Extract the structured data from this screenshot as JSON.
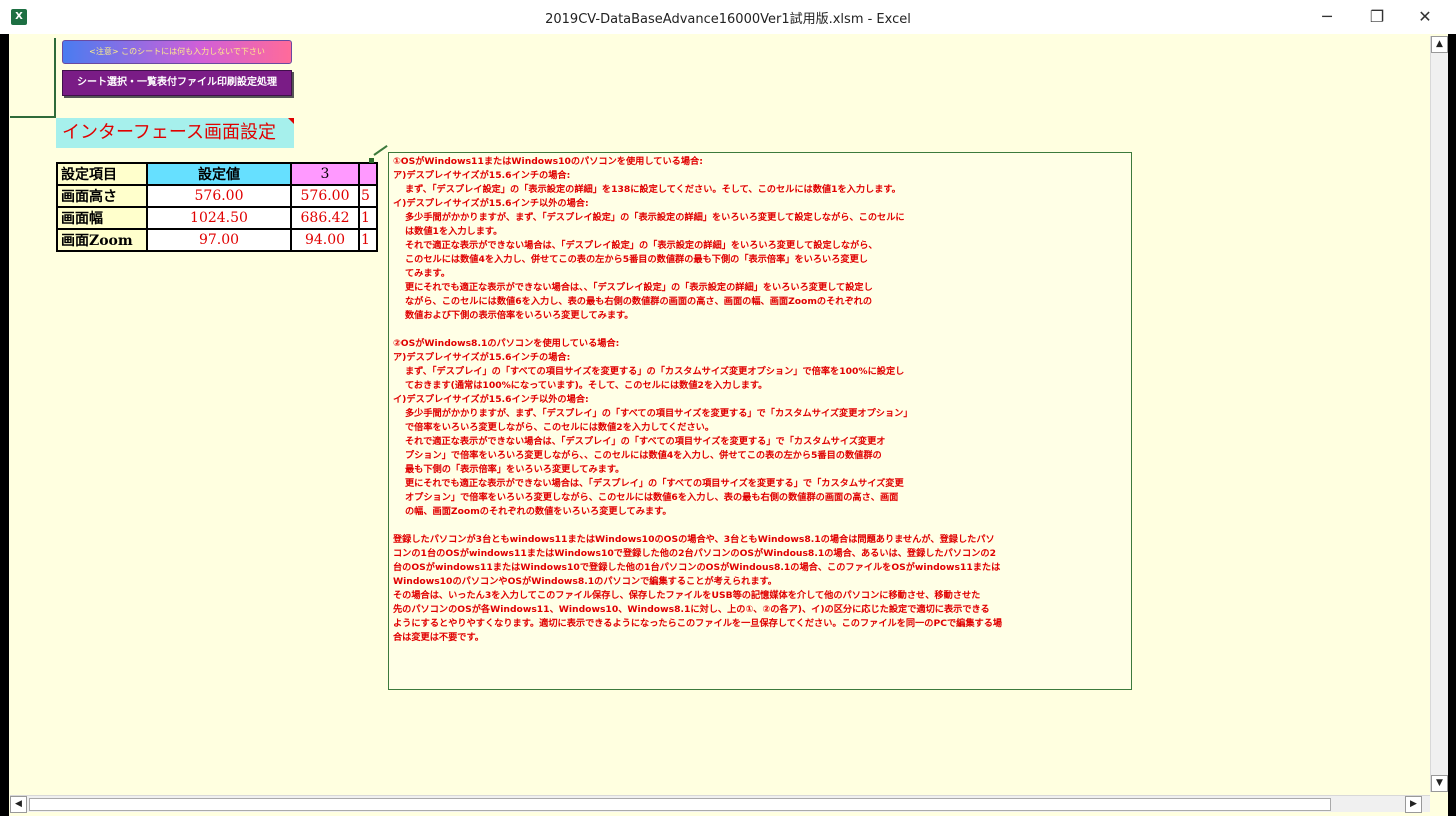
{
  "window": {
    "title": "2019CV-DataBaseAdvance16000Ver1試用版.xlsm - Excel",
    "app_icon": "excel-icon",
    "controls": [
      "minimize-icon",
      "restore-icon",
      "close-icon"
    ]
  },
  "buttons": {
    "notice": "<注意> このシートには何も入力しないで下さい",
    "print_setup": "シート選択・一覧表付ファイル印刷設定処理"
  },
  "section_title": "インターフェース画面設定",
  "settings_table": {
    "headers": [
      "設定項目",
      "設定値",
      "3",
      ""
    ],
    "rows": [
      {
        "label": "画面高さ",
        "value": "576.00",
        "v3": "576.00",
        "v4": "5"
      },
      {
        "label": "画面幅",
        "value": "1024.50",
        "v3": "686.42",
        "v4": "1"
      },
      {
        "label": "画面Zoom",
        "value": "97.00",
        "v3": "94.00",
        "v4": "1"
      }
    ]
  },
  "comment": {
    "lines": [
      "①OSがWindows11またはWindows10のパソコンを使用している場合:",
      "ア)デスプレイサイズが15.6インチの場合:",
      "  まず、「デスプレイ設定」の「表示設定の詳細」を138に設定してください。そして、このセルには数値1を入力します。",
      "イ)デスプレイサイズが15.6インチ以外の場合:",
      "  多少手間がかかりますが、まず、「デスプレイ設定」の「表示設定の詳細」をいろいろ変更して設定しながら、このセルに",
      "  は数値1を入力します。",
      "  それで適正な表示ができない場合は、「デスプレイ設定」の「表示設定の詳細」をいろいろ変更して設定しながら、",
      "  このセルには数値4を入力し、併せてこの表の左から5番目の数値群の最も下側の「表示倍率」をいろいろ変更し",
      "  てみます。",
      "  更にそれでも適正な表示ができない場合は、、「デスプレイ設定」の「表示設定の詳細」をいろいろ変更して設定し",
      "  ながら、このセルには数値6を入力し、表の最も右側の数値群の画面の高さ、画面の幅、画面Zoomのそれぞれの",
      "  数値および下側の表示倍率をいろいろ変更してみます。",
      "",
      "②OSがWindows8.1のパソコンを使用している場合:",
      "ア)デスプレイサイズが15.6インチの場合:",
      "  まず、「デスプレイ」の「すべての項目サイズを変更する」の「カスタムサイズ変更オプション」で倍率を100%に設定し",
      "  ておきます(通常は100%になっています)。そして、このセルには数値2を入力します。",
      "イ)デスプレイサイズが15.6インチ以外の場合:",
      "  多少手間がかかりますが、まず、「デスプレイ」の「すべての項目サイズを変更する」で「カスタムサイズ変更オプション」",
      "  で倍率をいろいろ変更しながら、このセルには数値2を入力してください。",
      "  それで適正な表示ができない場合は、「デスプレイ」の「すべての項目サイズを変更する」で「カスタムサイズ変更オ",
      "  プション」で倍率をいろいろ変更しながら、、このセルには数値4を入力し、併せてこの表の左から5番目の数値群の",
      "  最も下側の「表示倍率」をいろいろ変更してみます。",
      "  更にそれでも適正な表示ができない場合は、「デスプレイ」の「すべての項目サイズを変更する」で「カスタムサイズ変更",
      "  オプション」で倍率をいろいろ変更しながら、このセルには数値6を入力し、表の最も右側の数値群の画面の高さ、画面",
      "  の幅、画面Zoomのそれぞれの数値をいろいろ変更してみます。",
      "",
      "登録したパソコンが3台ともwindows11またはWindows10のOSの場合や、3台ともWindows8.1の場合は問題ありませんが、登録したパソ",
      "コンの1台のOSがwindows11またはWindows10で登録した他の2台パソコンのOSがWindous8.1の場合、あるいは、登録したパソコンの2",
      "台のOSがwindows11またはWindows10で登録した他の1台パソコンのOSがWindous8.1の場合、このファイルをOSがwindows11または",
      "Windows10のパソコンやOSがWindows8.1のパソコンで編集することが考えられます。",
      "その場合は、いったん3を入力してこのファイル保存し、保存したファイルをUSB等の記憶媒体を介して他のパソコンに移動させ、移動させた",
      "先のパソコンのOSが各Windows11、Windows10、Windows8.1に対し、上の①、②の各ア)、イ)の区分に応じた設定で適切に表示できる",
      "ようにするとやりやすくなります。適切に表示できるようになったらこのファイルを一旦保存してください。このファイルを同一のPCで編集する場",
      "合は変更は不要です。"
    ]
  }
}
